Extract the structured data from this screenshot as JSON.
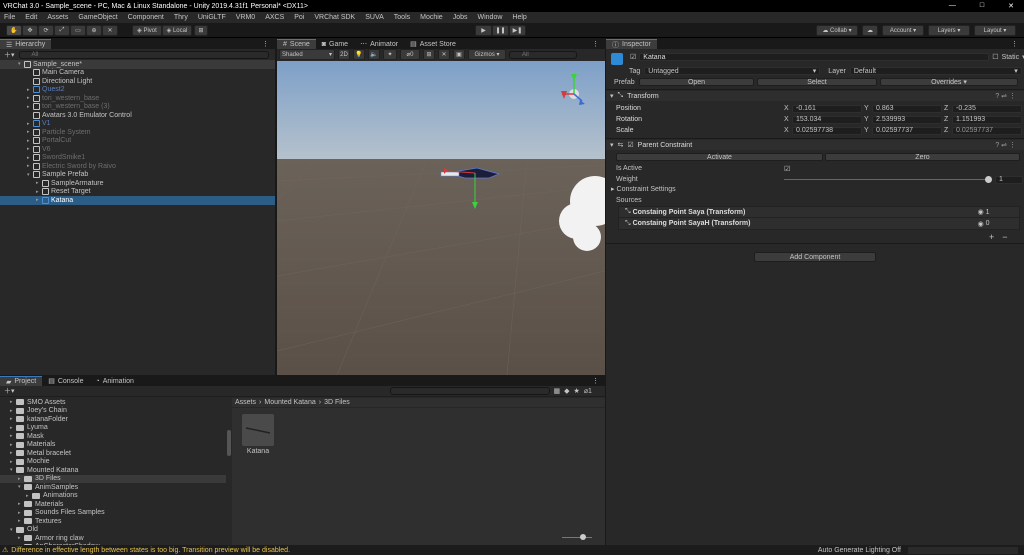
{
  "title": "VRChat 3.0 - Sample_scene - PC, Mac & Linux Standalone - Unity 2019.4.31f1 Personal* <DX11>",
  "window_controls": [
    "—",
    "□",
    "✕"
  ],
  "menu": [
    "File",
    "Edit",
    "Assets",
    "GameObject",
    "Component",
    "Thry",
    "UniGLTF",
    "VRM0",
    "AXCS",
    "Poi",
    "VRChat SDK",
    "SUVA",
    "Tools",
    "Mochie",
    "Jobs",
    "Window",
    "Help"
  ],
  "toolbar": {
    "pivot": "Pivot",
    "local": "Local",
    "collab": "Collab",
    "account": "Account",
    "layers": "Layers",
    "layout": "Layout"
  },
  "hierarchy": {
    "tab": "Hierarchy",
    "search": "All",
    "items": [
      {
        "label": "Sample_scene*",
        "depth": 0,
        "style": "scene"
      },
      {
        "label": "Main Camera",
        "depth": 1,
        "style": "normal"
      },
      {
        "label": "Directional Light",
        "depth": 1,
        "style": "normal"
      },
      {
        "label": "Quest2",
        "depth": 1,
        "style": "blue-dim"
      },
      {
        "label": "tori_western_base",
        "depth": 1,
        "style": "dim"
      },
      {
        "label": "tori_western_base (3)",
        "depth": 1,
        "style": "dim"
      },
      {
        "label": "Avatars 3.0 Emulator Control",
        "depth": 1,
        "style": "normal"
      },
      {
        "label": "V1",
        "depth": 1,
        "style": "blue-dim"
      },
      {
        "label": "Particle System",
        "depth": 1,
        "style": "dim"
      },
      {
        "label": "PortalCut",
        "depth": 1,
        "style": "dim"
      },
      {
        "label": "V6",
        "depth": 1,
        "style": "dim"
      },
      {
        "label": "SwordSmike1",
        "depth": 1,
        "style": "dim"
      },
      {
        "label": "Electric Sword by Raivo",
        "depth": 1,
        "style": "dim"
      },
      {
        "label": "Sample Prefab",
        "depth": 1,
        "style": "normal"
      },
      {
        "label": "SampleArmature",
        "depth": 2,
        "style": "normal"
      },
      {
        "label": "Reset Target",
        "depth": 2,
        "style": "normal"
      },
      {
        "label": "Katana",
        "depth": 2,
        "style": "selected"
      }
    ]
  },
  "scene": {
    "tabs": [
      "Scene",
      "Game",
      "Animator",
      "Asset Store"
    ],
    "shading": "Shaded",
    "mode2d": "2D",
    "count": "0",
    "gizmos": "Gizmos",
    "search": "All"
  },
  "project": {
    "tabs": [
      "Project",
      "Console",
      "Animation"
    ],
    "badge": "1",
    "tree": [
      {
        "label": "SMO Assets",
        "depth": 1
      },
      {
        "label": "Joey's Chain",
        "depth": 1
      },
      {
        "label": "katanaFolder",
        "depth": 1
      },
      {
        "label": "Lyuma",
        "depth": 1
      },
      {
        "label": "Mask",
        "depth": 1
      },
      {
        "label": "Materials",
        "depth": 1
      },
      {
        "label": "Metal bracelet",
        "depth": 1
      },
      {
        "label": "Mochie",
        "depth": 1
      },
      {
        "label": "Mounted Katana",
        "depth": 1
      },
      {
        "label": "3D Files",
        "depth": 2
      },
      {
        "label": "AnimSamples",
        "depth": 2
      },
      {
        "label": "Animations",
        "depth": 3
      },
      {
        "label": "Materials",
        "depth": 2
      },
      {
        "label": "Sounds Files Samples",
        "depth": 2
      },
      {
        "label": "Textures",
        "depth": 2
      },
      {
        "label": "Old",
        "depth": 1
      },
      {
        "label": "Armor ring claw",
        "depth": 2
      },
      {
        "label": "AnCharacterShadow",
        "depth": 2
      }
    ],
    "breadcrumb": [
      "Assets",
      "Mounted Katana",
      "3D Files"
    ],
    "asset_label": "Katana"
  },
  "inspector": {
    "tab": "Inspector",
    "name": "Katana",
    "static": "Static",
    "tag_label": "Tag",
    "tag": "Untagged",
    "layer_label": "Layer",
    "layer": "Default",
    "prefab_label": "Prefab",
    "prefab_buttons": [
      "Open",
      "Select",
      "Overrides"
    ],
    "transform": {
      "title": "Transform",
      "rows": [
        {
          "label": "Position",
          "x": "-0.161",
          "y": "0.863",
          "z": "-0.235"
        },
        {
          "label": "Rotation",
          "x": "153.034",
          "y": "2.539993",
          "z": "1.151993"
        },
        {
          "label": "Scale",
          "x": "0.02597738",
          "y": "0.02597737",
          "z": "0.02597737"
        }
      ]
    },
    "constraint": {
      "title": "Parent Constraint",
      "activate": "Activate",
      "zero": "Zero",
      "is_active": "Is Active",
      "weight": "Weight",
      "weight_value": "1",
      "settings": "Constraint Settings",
      "sources": "Sources",
      "items": [
        {
          "label": "Constaing Point Saya (Transform)",
          "value": "1"
        },
        {
          "label": "Constaing Point SayaH (Transform)",
          "value": "0"
        }
      ]
    },
    "add_component": "Add Component"
  },
  "status": {
    "message": "Difference in effective length between states is too big. Transition preview will be disabled.",
    "right": "Auto Generate Lighting Off"
  }
}
